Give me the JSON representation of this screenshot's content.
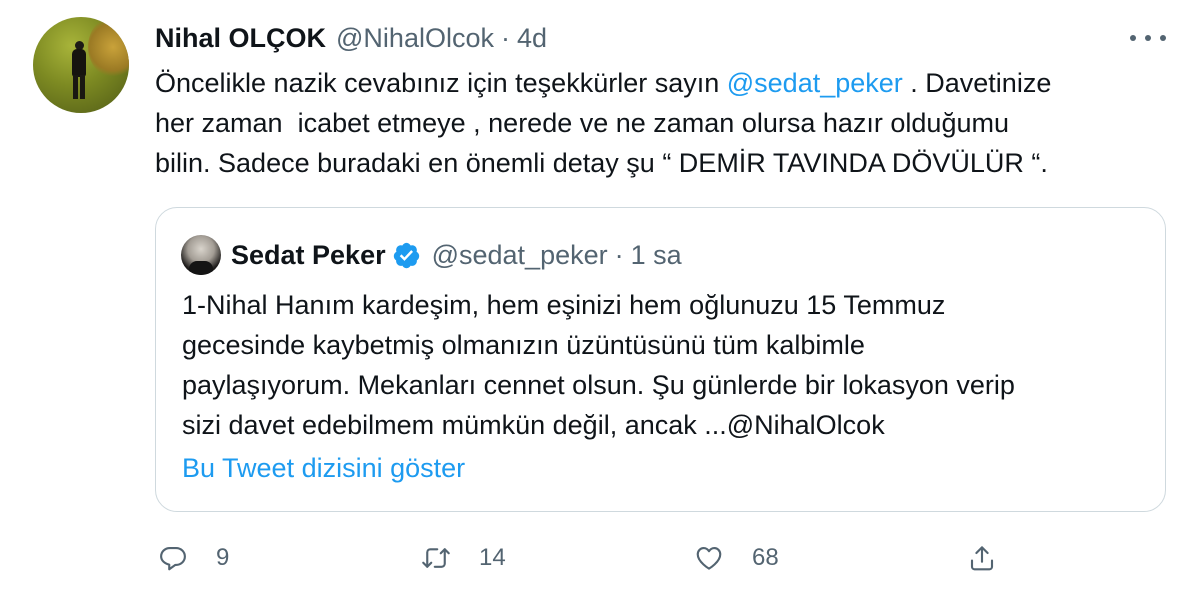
{
  "tweet": {
    "display_name": "Nihal OLÇOK",
    "handle": "@NihalOlcok",
    "separator": "·",
    "time": "4d",
    "text_lines": [
      [
        "Öncelikle nazik cevabınız için teşekkürler sayın ",
        "@sedat_peker",
        " . Davetinize"
      ],
      [
        "her zaman  icabet etmeye , nerede ve ne zaman olursa hazır olduğumu"
      ],
      [
        "bilin. Sadece buradaki en önemli detay şu “ DEMİR TAVINDA DÖVÜLÜR “."
      ]
    ],
    "more_icon": "more-dots-icon"
  },
  "quote": {
    "display_name": "Sedat Peker",
    "verified_icon": "verified-badge-icon",
    "handle": "@sedat_peker",
    "separator": "·",
    "time": "1 sa",
    "text_lines": [
      "1-Nihal Hanım kardeşim, hem eşinizi hem oğlunuzu 15 Temmuz",
      "gecesinde kaybetmiş olmanızın üzüntüsünü tüm kalbimle",
      "paylaşıyorum. Mekanları cennet olsun. Şu günlerde bir lokasyon verip",
      "sizi davet edebilmem mümkün değil, ancak ...@NihalOlcok"
    ],
    "thread_link": "Bu Tweet dizisini göster"
  },
  "actions": {
    "reply": {
      "icon": "reply-icon",
      "count": "9"
    },
    "retweet": {
      "icon": "retweet-icon",
      "count": "14"
    },
    "like": {
      "icon": "heart-icon",
      "count": "68"
    },
    "share": {
      "icon": "share-icon"
    }
  },
  "colors": {
    "accent": "#1d9bf0",
    "secondary_text": "#536471",
    "border": "#cfd9de"
  }
}
